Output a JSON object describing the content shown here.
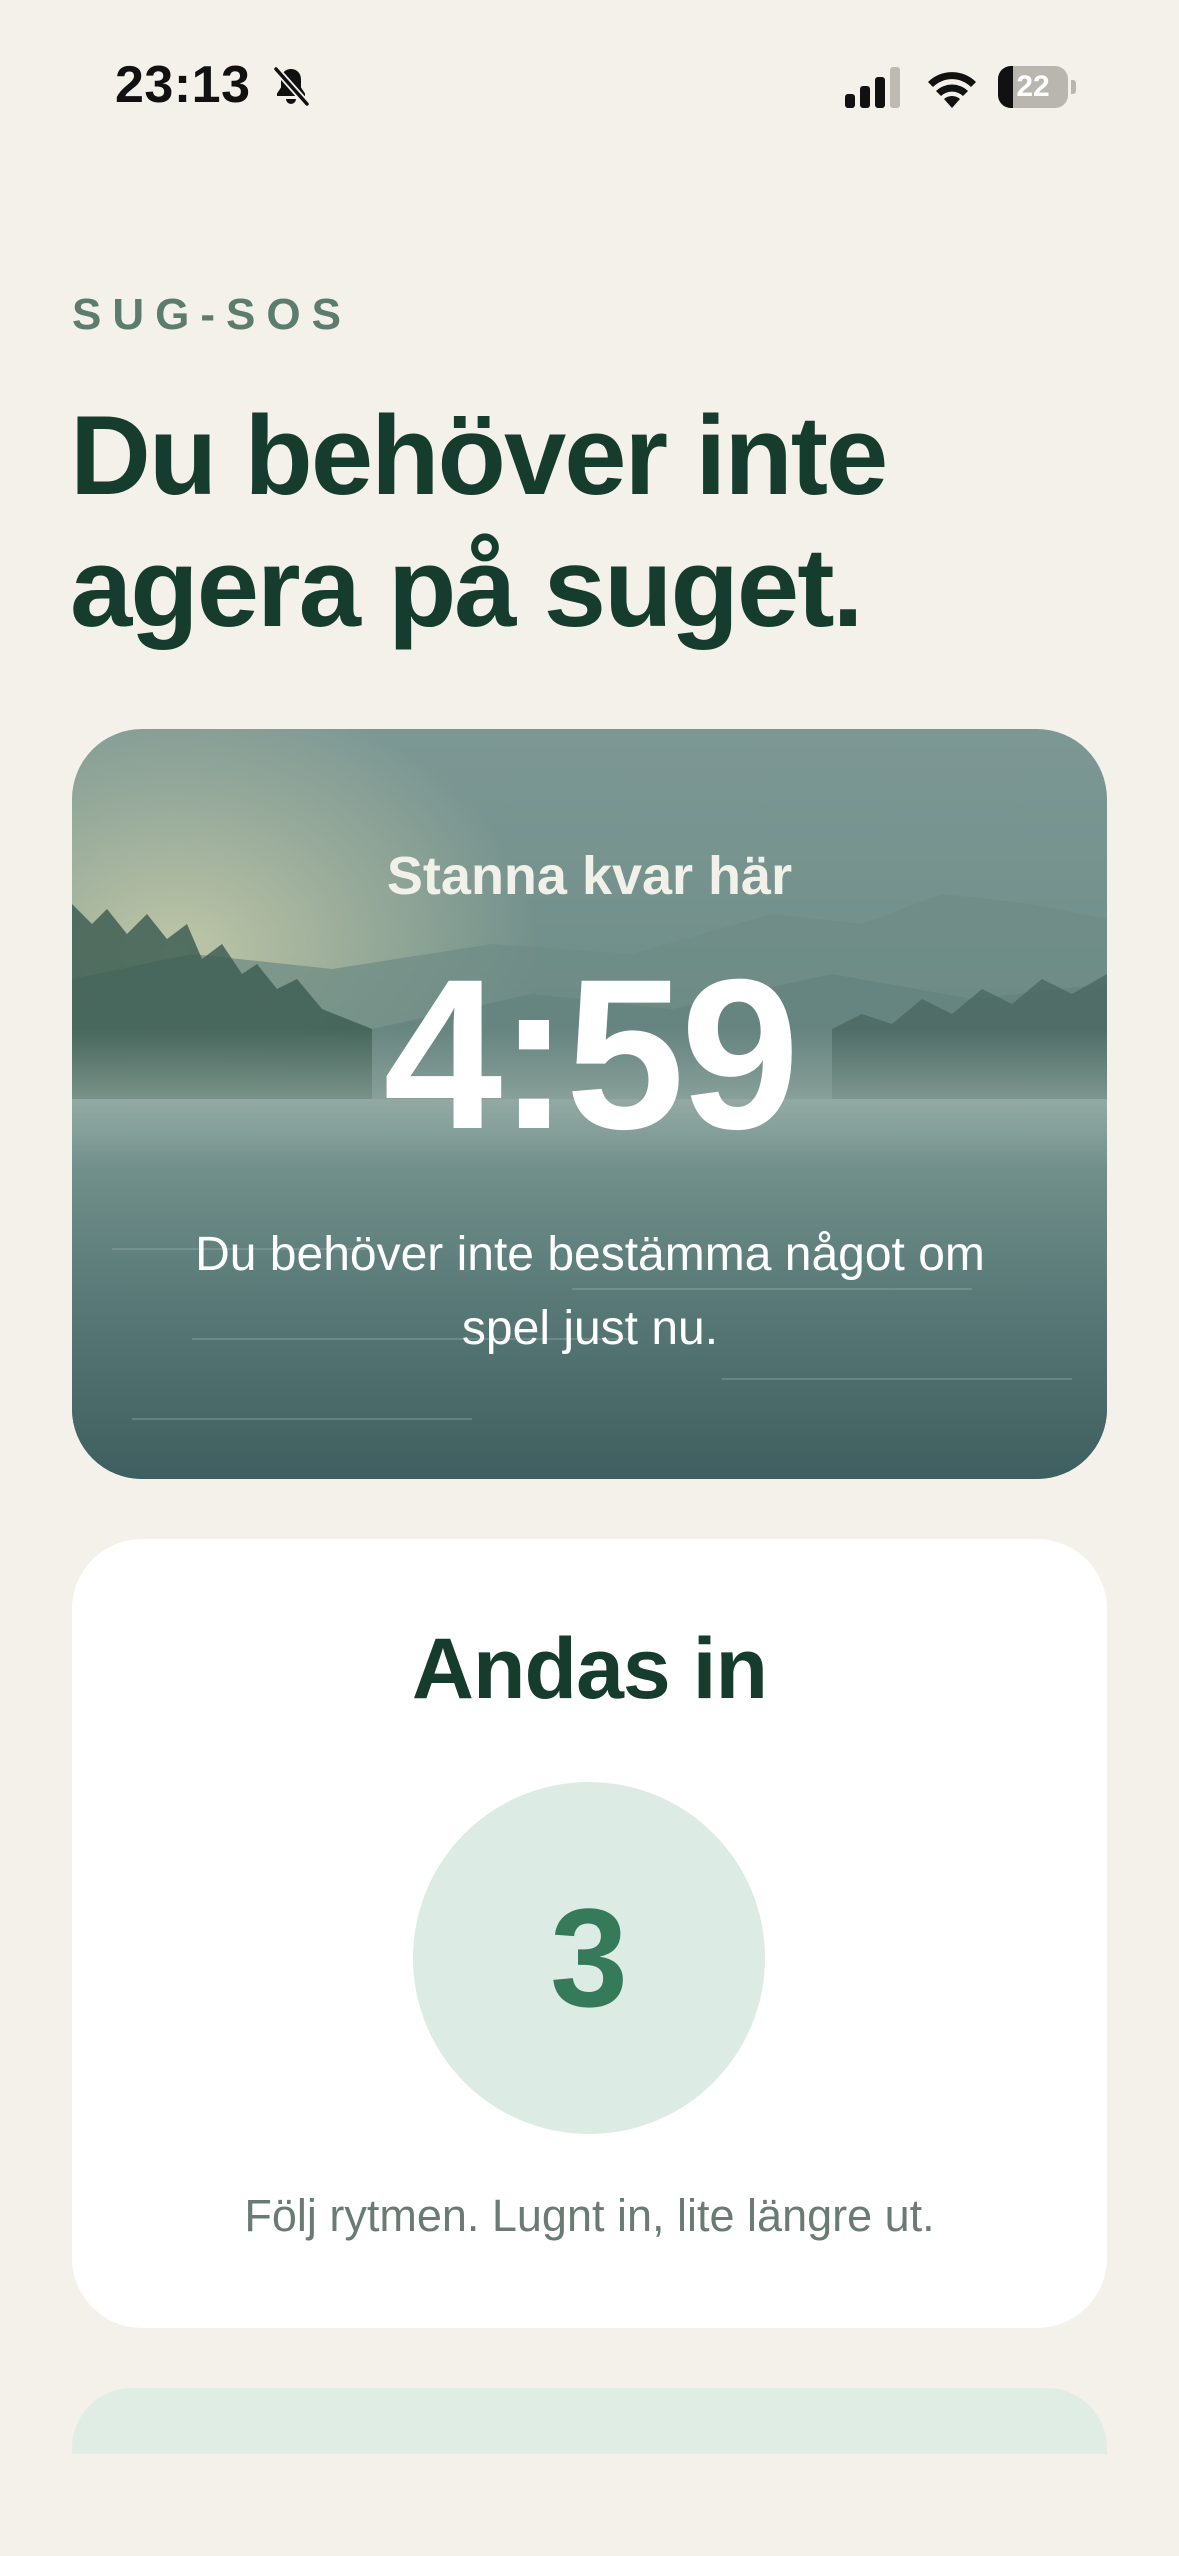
{
  "status_bar": {
    "time": "23:13",
    "battery_level": "22",
    "battery_fraction": 0.22
  },
  "header": {
    "eyebrow": "SUG-SOS",
    "headline": "Du behöver inte agera på suget."
  },
  "timer_card": {
    "label": "Stanna kvar här",
    "time_remaining": "4:59",
    "message": "Du behöver inte bestämma något om spel just nu."
  },
  "breathing_card": {
    "title": "Andas in",
    "count": "3",
    "hint": "Följ rytmen. Lugnt in, lite längre ut."
  },
  "colors": {
    "background": "#f3f1ea",
    "primary_dark_green": "#163c2e",
    "accent_green": "#357a59",
    "eyebrow_green": "#5c7d6d",
    "soft_mint": "#dcebe3"
  },
  "icons": [
    "bell-slash-icon",
    "cellular-signal-icon",
    "wifi-icon",
    "battery-icon"
  ]
}
